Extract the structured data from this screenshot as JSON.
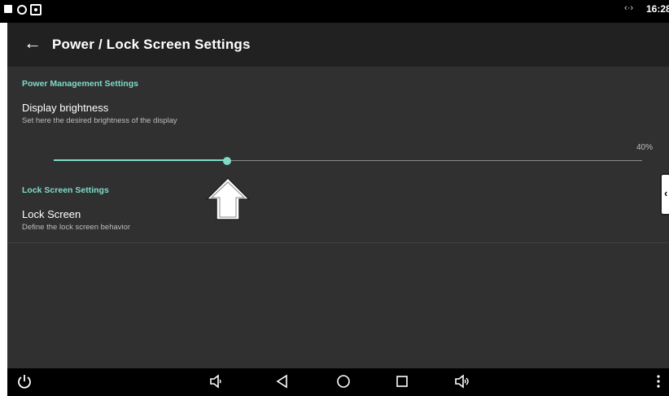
{
  "status_bar": {
    "time": "16:28",
    "network_icon": "data-transfer-icon",
    "left_icons": [
      "square-notification-icon",
      "ring-notification-icon",
      "camera-notification-icon"
    ]
  },
  "app_bar": {
    "back_label": "←",
    "title": "Power / Lock Screen Settings"
  },
  "power_section": {
    "header": "Power Management Settings",
    "brightness": {
      "title": "Display brightness",
      "summary": "Set here the desired brightness of the display",
      "value_label": "40%",
      "value_fraction": 0.295
    }
  },
  "lock_section": {
    "header": "Lock Screen Settings",
    "lock_screen": {
      "title": "Lock Screen",
      "summary": "Define the lock screen behavior"
    }
  },
  "nav_bar": {
    "buttons": [
      "power-icon",
      "volume-down-icon",
      "back-icon",
      "home-icon",
      "recents-icon",
      "volume-up-icon",
      "more-vert-icon"
    ]
  },
  "colors": {
    "accent": "#7fdbc8",
    "background": "#303030",
    "app_bar": "#212121"
  }
}
